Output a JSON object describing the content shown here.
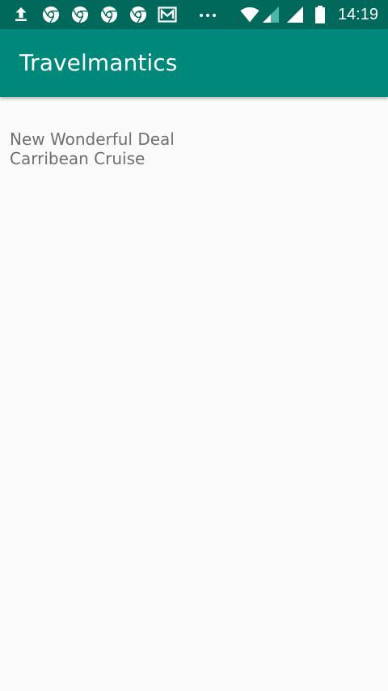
{
  "status_bar": {
    "time": "14:19",
    "icons": [
      "upload-icon",
      "chrome-icon",
      "chrome-icon",
      "chrome-icon",
      "chrome-icon",
      "gmail-icon",
      "more-dots-icon",
      "wifi-icon",
      "signal-weak-icon",
      "signal-icon",
      "battery-icon"
    ]
  },
  "app_bar": {
    "title": "Travelmantics",
    "color": "#00897b"
  },
  "deals": [
    {
      "title": "New Wonderful Deal",
      "subtitle": "Carribean Cruise"
    }
  ],
  "colors": {
    "status_bar": "#00695c",
    "background": "#fafafa",
    "text": "#6f6f6f"
  }
}
